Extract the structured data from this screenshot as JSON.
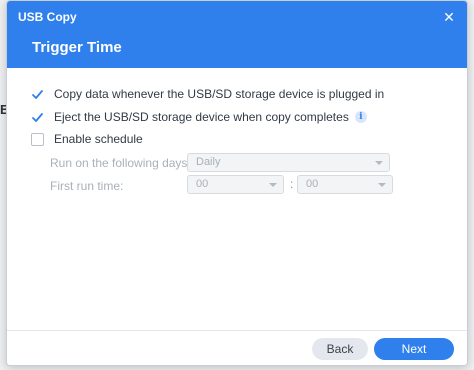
{
  "window": {
    "app_title": "USB Copy",
    "step_title": "Trigger Time",
    "close_glyph": "✕"
  },
  "background": {
    "partial_text": "E"
  },
  "options": [
    {
      "label": "Copy data whenever the USB/SD storage device is plugged in",
      "checked": true
    },
    {
      "label": "Eject the USB/SD storage device when copy completes",
      "checked": true,
      "info_icon": "info-icon"
    },
    {
      "label": "Enable schedule",
      "checked": false
    }
  ],
  "schedule": {
    "days_label": "Run on the following days:",
    "days_value": "Daily",
    "time_label": "First run time:",
    "hour_value": "00",
    "minute_value": "00",
    "separator": ":"
  },
  "footer": {
    "back_label": "Back",
    "next_label": "Next"
  },
  "colors": {
    "accent": "#2f80ed",
    "title_text": "#ffffff"
  }
}
